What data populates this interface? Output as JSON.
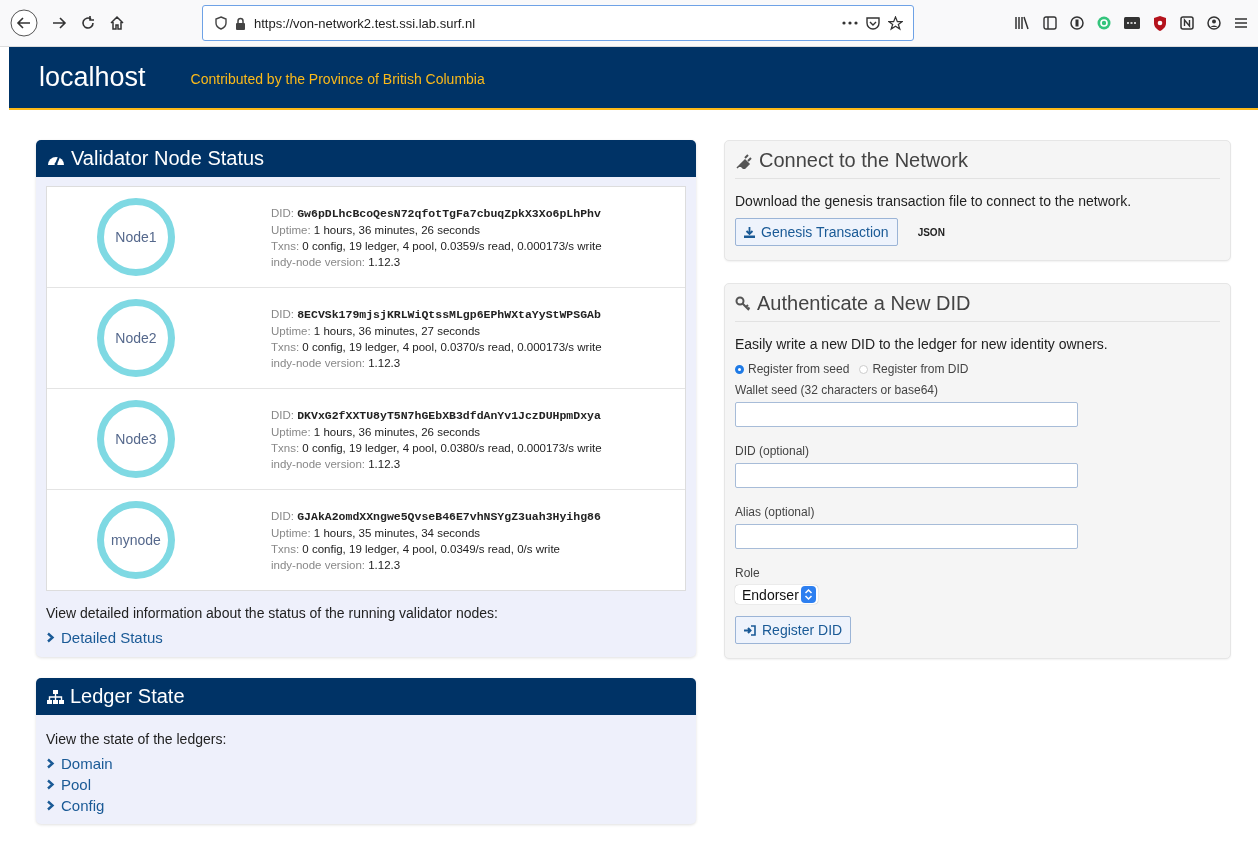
{
  "browser": {
    "url": "https://von-network2.test.ssi.lab.surf.nl"
  },
  "header": {
    "title": "localhost",
    "subtitle": "Contributed by the Province of British Columbia"
  },
  "validator_status": {
    "title": "Validator Node Status",
    "nodes": [
      {
        "name": "Node1",
        "fields": [
          {
            "kind": "mono",
            "label": "DID:",
            "value": "Gw6pDLhcBcoQesN72qfotTgFa7cbuqZpkX3Xo6pLhPhv"
          },
          {
            "kind": "plain",
            "label": "Uptime:",
            "value": "1 hours, 36 minutes, 26 seconds"
          },
          {
            "kind": "plain",
            "label": "Txns:",
            "value": "0 config, 19 ledger, 4 pool, 0.0359/s read, 0.000173/s write"
          },
          {
            "kind": "plain",
            "label": "indy-node version:",
            "value": "1.12.3"
          }
        ]
      },
      {
        "name": "Node2",
        "fields": [
          {
            "kind": "mono",
            "label": "DID:",
            "value": "8ECVSk179mjsjKRLWiQtssMLgp6EPhWXtaYyStWPSGAb"
          },
          {
            "kind": "plain",
            "label": "Uptime:",
            "value": "1 hours, 36 minutes, 27 seconds"
          },
          {
            "kind": "plain",
            "label": "Txns:",
            "value": "0 config, 19 ledger, 4 pool, 0.0370/s read, 0.000173/s write"
          },
          {
            "kind": "plain",
            "label": "indy-node version:",
            "value": "1.12.3"
          }
        ]
      },
      {
        "name": "Node3",
        "fields": [
          {
            "kind": "mono",
            "label": "DID:",
            "value": "DKVxG2fXXTU8yT5N7hGEbXB3dfdAnYv1JczDUHpmDxya"
          },
          {
            "kind": "plain",
            "label": "Uptime:",
            "value": "1 hours, 36 minutes, 26 seconds"
          },
          {
            "kind": "plain",
            "label": "Txns:",
            "value": "0 config, 19 ledger, 4 pool, 0.0380/s read, 0.000173/s write"
          },
          {
            "kind": "plain",
            "label": "indy-node version:",
            "value": "1.12.3"
          }
        ]
      },
      {
        "name": "mynode",
        "fields": [
          {
            "kind": "mono",
            "label": "DID:",
            "value": "GJAkA2omdXXngwe5QvseB46E7vhNSYgZ3uah3Hyihg86"
          },
          {
            "kind": "plain",
            "label": "Uptime:",
            "value": "1 hours, 35 minutes, 34 seconds"
          },
          {
            "kind": "plain",
            "label": "Txns:",
            "value": "0 config, 19 ledger, 4 pool, 0.0349/s read, 0/s write"
          },
          {
            "kind": "plain",
            "label": "indy-node version:",
            "value": "1.12.3"
          }
        ]
      }
    ],
    "description": "View detailed information about the status of the running validator nodes:",
    "link": "Detailed Status"
  },
  "ledger_state": {
    "title": "Ledger State",
    "description": "View the state of the ledgers:",
    "links": [
      "Domain",
      "Pool",
      "Config"
    ]
  },
  "connect": {
    "title": "Connect to the Network",
    "description": "Download the genesis transaction file to connect to the network.",
    "button": "Genesis Transaction",
    "link": "JSON"
  },
  "authenticate": {
    "title": "Authenticate a New DID",
    "description": "Easily write a new DID to the ledger for new identity owners.",
    "radios": [
      {
        "label": "Register from seed",
        "selected": true
      },
      {
        "label": "Register from DID",
        "selected": false
      }
    ],
    "fields": [
      {
        "label": "Wallet seed (32 characters or base64)"
      },
      {
        "label": "DID (optional)"
      },
      {
        "label": "Alias (optional)"
      }
    ],
    "role": {
      "label": "Role",
      "value": "Endorser"
    },
    "button": "Register DID"
  }
}
